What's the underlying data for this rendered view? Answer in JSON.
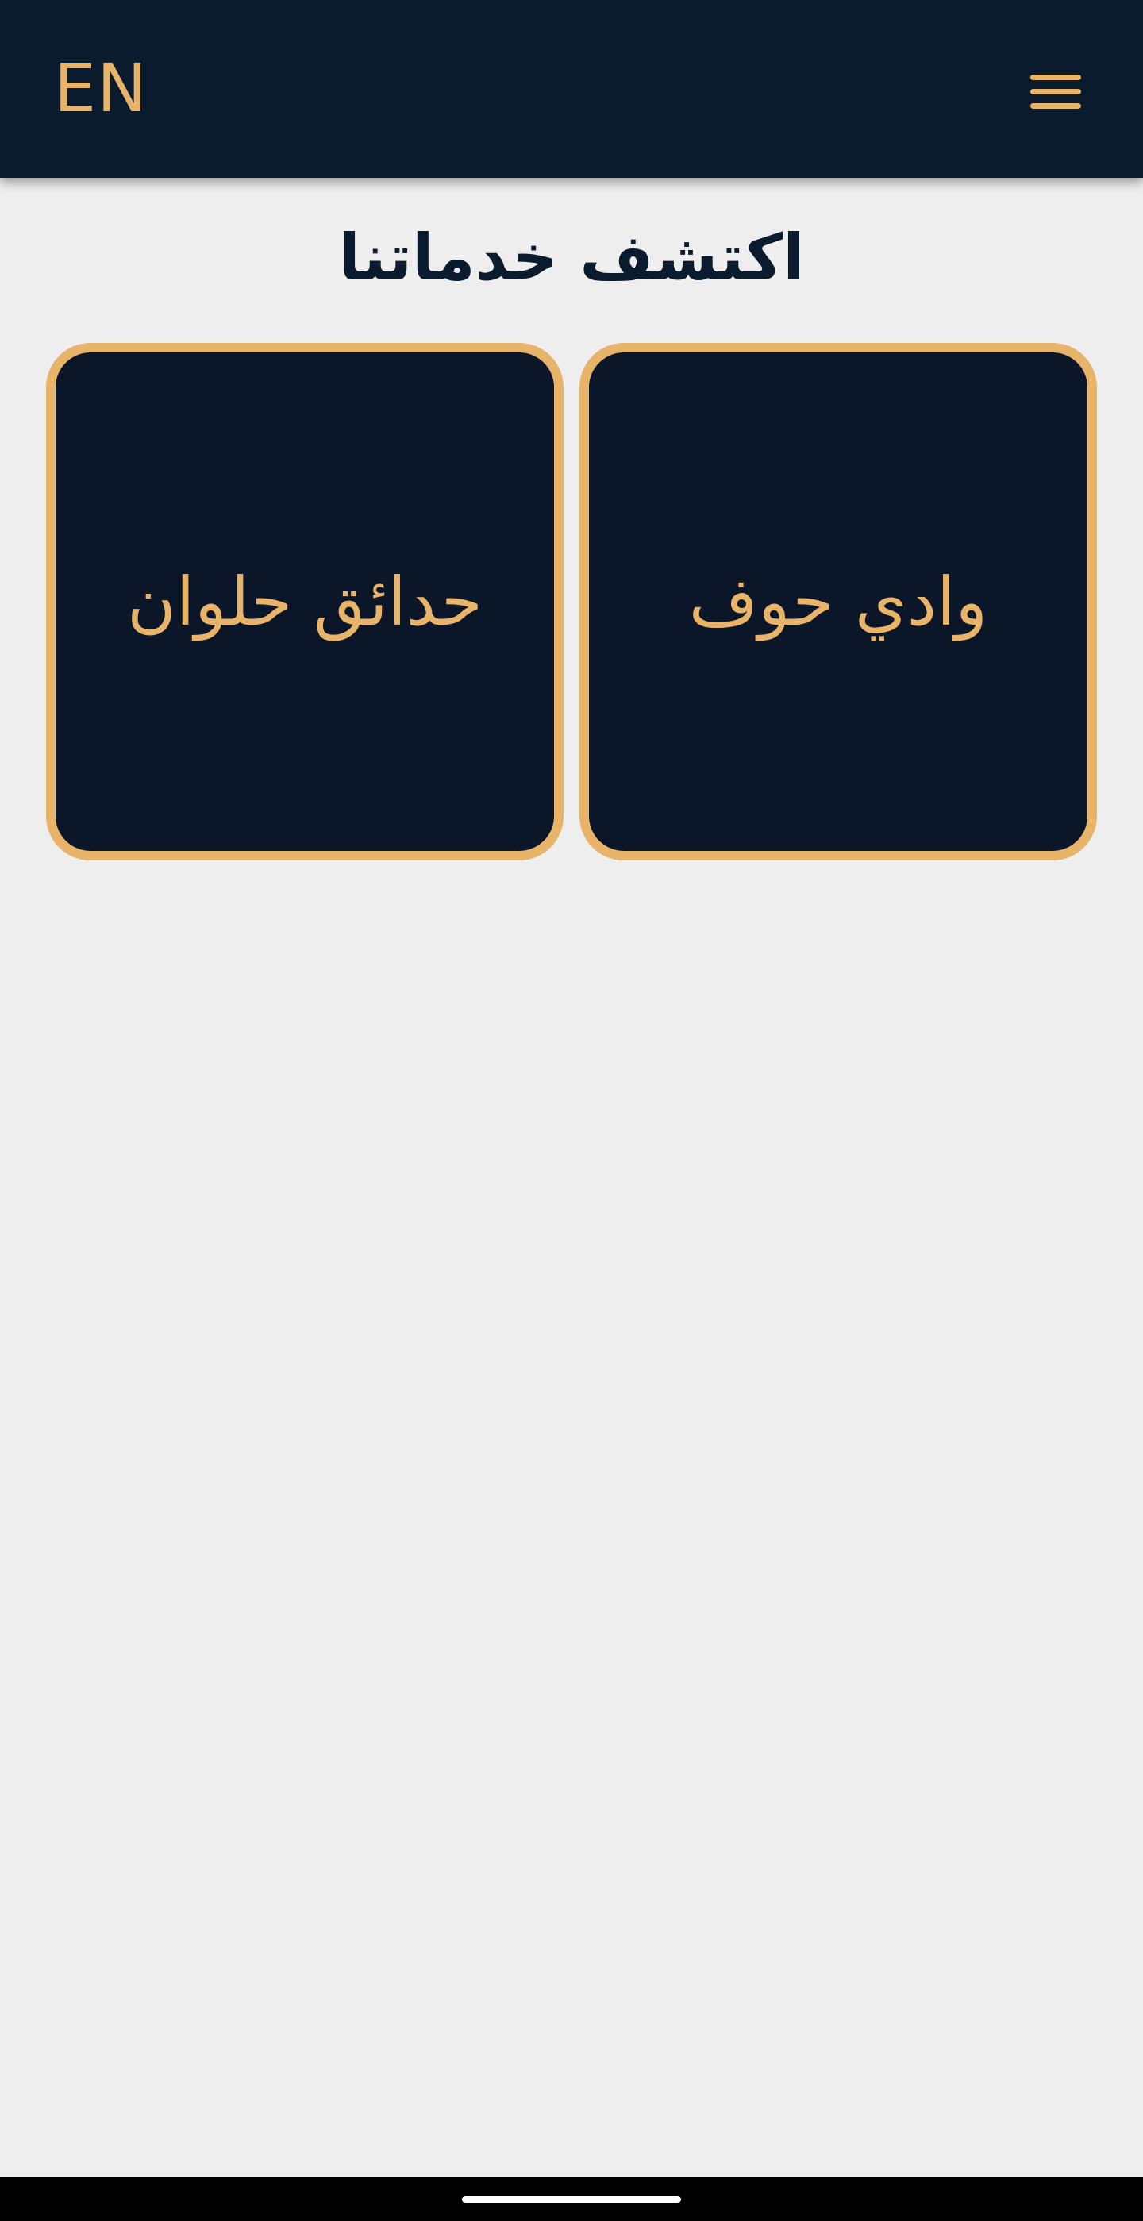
{
  "header": {
    "language_label": "EN",
    "menu_icon": "hamburger-menu-icon"
  },
  "main": {
    "title": "اكتشف خدماتنا",
    "services": [
      {
        "label": "وادي حوف"
      },
      {
        "label": "حدائق حلوان"
      }
    ]
  },
  "colors": {
    "header_bg": "#0b1b2e",
    "accent": "#e8b46a",
    "page_bg": "#eeeeee",
    "card_bg": "#0b1729",
    "title_text": "#0b1b2e"
  }
}
